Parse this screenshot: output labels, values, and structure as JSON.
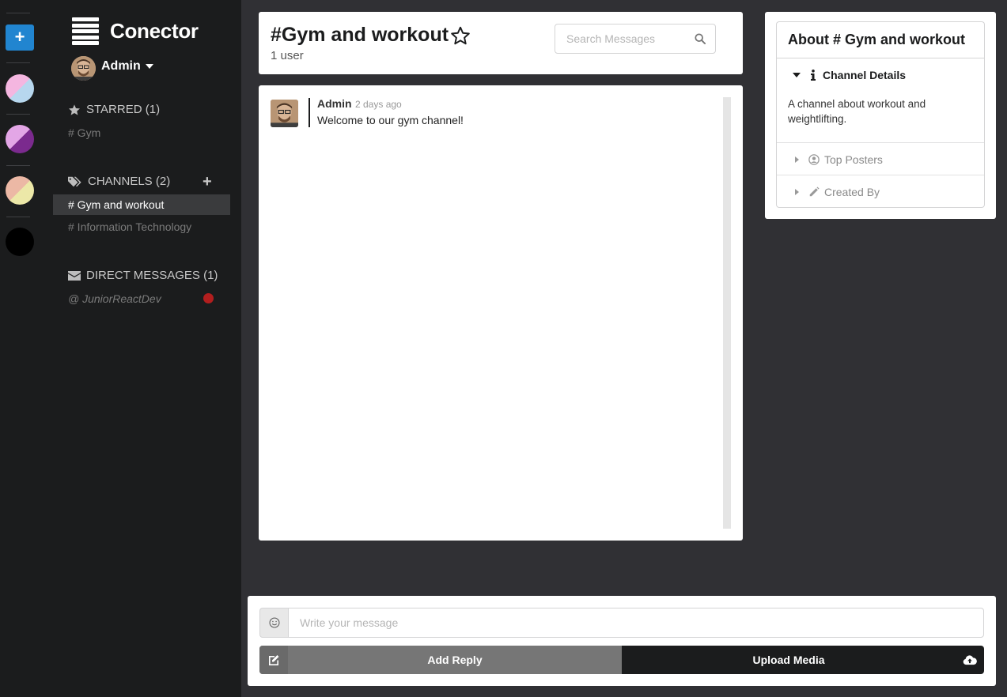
{
  "app": {
    "title": "Conector"
  },
  "color_rail": {
    "add_label": "+",
    "swatches": [
      {
        "primary": "#f4b6e0",
        "secondary": "#b7d7ee"
      },
      {
        "primary": "#e3a6e6",
        "secondary": "#7b2a8e"
      },
      {
        "primary": "#ecb8a5",
        "secondary": "#ece8a8"
      },
      {
        "primary": "#000000",
        "secondary": "#000000"
      }
    ]
  },
  "user": {
    "name": "Admin"
  },
  "starred": {
    "header": "STARRED (1)",
    "items": [
      "# Gym"
    ]
  },
  "channels": {
    "header": "CHANNELS (2)",
    "add_label": "+",
    "items": [
      "# Gym and workout",
      "# Information Technology"
    ],
    "active": "# Gym and workout"
  },
  "direct_messages": {
    "header": "DIRECT MESSAGES (1)",
    "items": [
      {
        "label": "@ JuniorReactDev",
        "status_color": "#b21e1e"
      }
    ]
  },
  "messages_header": {
    "channel_name": "#Gym and workout",
    "user_count": "1 user",
    "search_placeholder": "Search Messages"
  },
  "messages": [
    {
      "author": "Admin",
      "time": "2 days ago",
      "text": "Welcome to our gym channel!"
    }
  ],
  "meta_panel": {
    "title": "About # Gym and workout",
    "channel_details_label": "Channel Details",
    "channel_details_text": "A channel about workout and weightlifting.",
    "top_posters_label": "Top Posters",
    "created_by_label": "Created By"
  },
  "message_form": {
    "placeholder": "Write your message",
    "reply_label": "Add Reply",
    "upload_label": "Upload Media"
  }
}
